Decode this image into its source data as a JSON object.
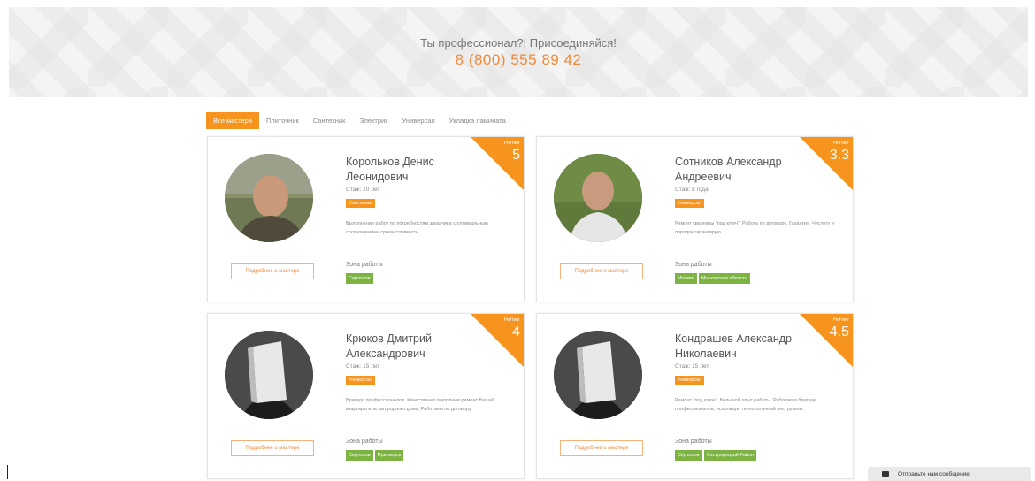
{
  "banner": {
    "tagline": "Ты профессионал?! Присоединяйся!",
    "phone": "8 (800) 555 89 42"
  },
  "tabs": [
    "Все мастера",
    "Плиточник",
    "Сантехник",
    "Электрик",
    "Универсал",
    "Укладка ламината"
  ],
  "masters": [
    {
      "name": "Корольков Денис Леонидович",
      "experience": "Стаж: 10 лет",
      "specialty": "Сантехник",
      "description": "Выполнение работ по потребностям заказчика с оптимальным соотношением сроки-стоимость.",
      "zone_label": "Зона работы",
      "zones": [
        "Сертолов"
      ],
      "rating_label": "Рейтинг",
      "rating": "5",
      "more": "Подробнее о мастере",
      "avatar": "photo"
    },
    {
      "name": "Сотников Александр Андреевич",
      "experience": "Стаж: 8 года",
      "specialty": "Универсал",
      "description": "Ремонт квартиры \"под ключ\". Работа по договору. Гарантия. Чистоту и порядок гарантирую.",
      "zone_label": "Зона работы",
      "zones": [
        "Москва",
        "Московская область"
      ],
      "rating_label": "Рейтинг",
      "rating": "3.3",
      "more": "Подробнее о мастере",
      "avatar": "photo"
    },
    {
      "name": "Крюков Дмитрий Александрович",
      "experience": "Стаж: 15 лет",
      "specialty": "Универсал",
      "description": "Бригада профессионалов. Качественно выполним ремонт Вашей квартиры или загородного дома. Работаем по договору.",
      "zone_label": "Зона работы",
      "zones": [
        "Сертолов",
        "Приозерск"
      ],
      "rating_label": "Рейтинг",
      "rating": "4",
      "more": "Подробнее о мастере",
      "avatar": "box-head"
    },
    {
      "name": "Кондрашев Александр Николаевич",
      "experience": "Стаж: 15 лет",
      "specialty": "Универсал",
      "description": "Ремонт \"под ключ\". Большой опыт работы. Работаю в бригаде профессионалов, использую технологичный инструмент.",
      "zone_label": "Зона работы",
      "zones": [
        "Сертолов",
        "Сестрорецкий Район"
      ],
      "rating_label": "Рейтинг",
      "rating": "4.5",
      "more": "Подробнее о мастере",
      "avatar": "box-head"
    }
  ],
  "chat": {
    "label": "Отправьте нам сообщение"
  },
  "colors": {
    "accent": "#f7941d",
    "phone": "#f0893a",
    "zone": "#7cb342"
  }
}
